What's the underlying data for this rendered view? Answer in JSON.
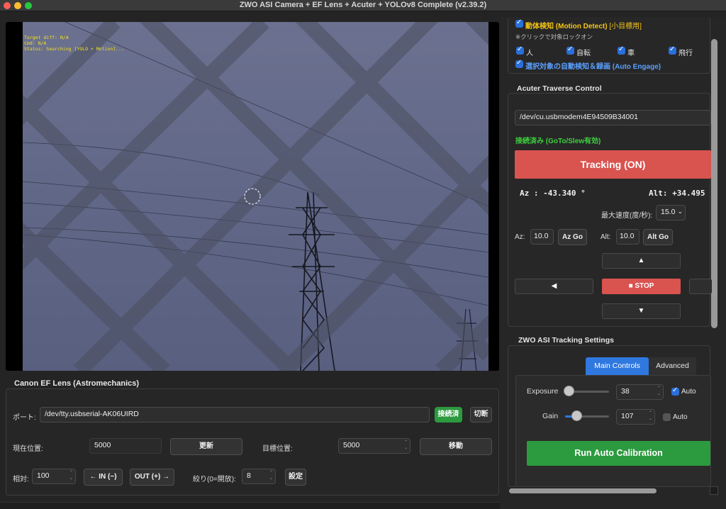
{
  "window": {
    "title": "ZWO ASI Camera + EF Lens + Acuter + YOLOv8 Complete (v2.39.2)"
  },
  "video": {
    "overlay": {
      "line1": "Target diff: N/A",
      "line2": "Cmd: N/A",
      "line3": "Status: Searching [YOLO + Motion]..."
    }
  },
  "lens": {
    "title": "Canon EF Lens (Astromechanics)",
    "port_label": "ポート:",
    "port_value": "/dev/tty.usbserial-AK06UIRD",
    "connected_btn": "接続済",
    "disconnect_btn": "切断",
    "current_label": "現在位置:",
    "current_value": "5000",
    "refresh_btn": "更新",
    "target_label": "目標位置:",
    "target_value": "5000",
    "move_btn": "移動",
    "relative_label": "相対:",
    "relative_value": "100",
    "in_btn": "← IN (−)",
    "out_btn": "OUT (+) →",
    "aperture_label": "絞り(0=開放):",
    "aperture_value": "8",
    "set_btn": "設定"
  },
  "motion": {
    "header": "動体検知 (Motion Detect)",
    "header_tag": "[小目標用]",
    "hint": "※クリックで対象ロックオン",
    "classes": [
      {
        "label": "人",
        "checked": true
      },
      {
        "label": "自転",
        "checked": true
      },
      {
        "label": "車",
        "checked": true
      },
      {
        "label": "飛行",
        "checked": true
      }
    ],
    "auto_engage": "選択対象の自動検知＆録画 (Auto Engage)"
  },
  "acuter": {
    "title": "Acuter Traverse Control",
    "port": "/dev/cu.usbmodem4E94509B34001",
    "status": "接続済み (GoTo/Slew有効)",
    "tracking_btn": "Tracking (ON)",
    "az_readout": "Az :  -43.340 °",
    "alt_readout": "Alt:  +34.495",
    "max_speed_label": "最大速度(度/秒):",
    "max_speed_value": "15.0",
    "az_label": "Az:",
    "az_value": "10.0",
    "az_go": "Az Go",
    "alt_label": "Alt:",
    "alt_value": "10.0",
    "alt_go": "Alt Go",
    "up": "▲",
    "left": "◀",
    "stop": "■ STOP",
    "down": "▼"
  },
  "tracking": {
    "title": "ZWO ASI  Tracking Settings",
    "tabs": [
      "Main Controls",
      "Advanced"
    ],
    "exposure_label": "Exposure",
    "exposure_value": "38",
    "exposure_level": 0.0,
    "exposure_auto": true,
    "gain_label": "Gain",
    "gain_value": "107",
    "gain_level": 0.22,
    "gain_auto": false,
    "auto_label": "Auto",
    "calibrate_btn": "Run Auto Calibration"
  },
  "colors": {
    "accent": "#2f78e0",
    "danger": "#d9534f",
    "success": "#2c9a3f",
    "warning": "#f5c518"
  }
}
